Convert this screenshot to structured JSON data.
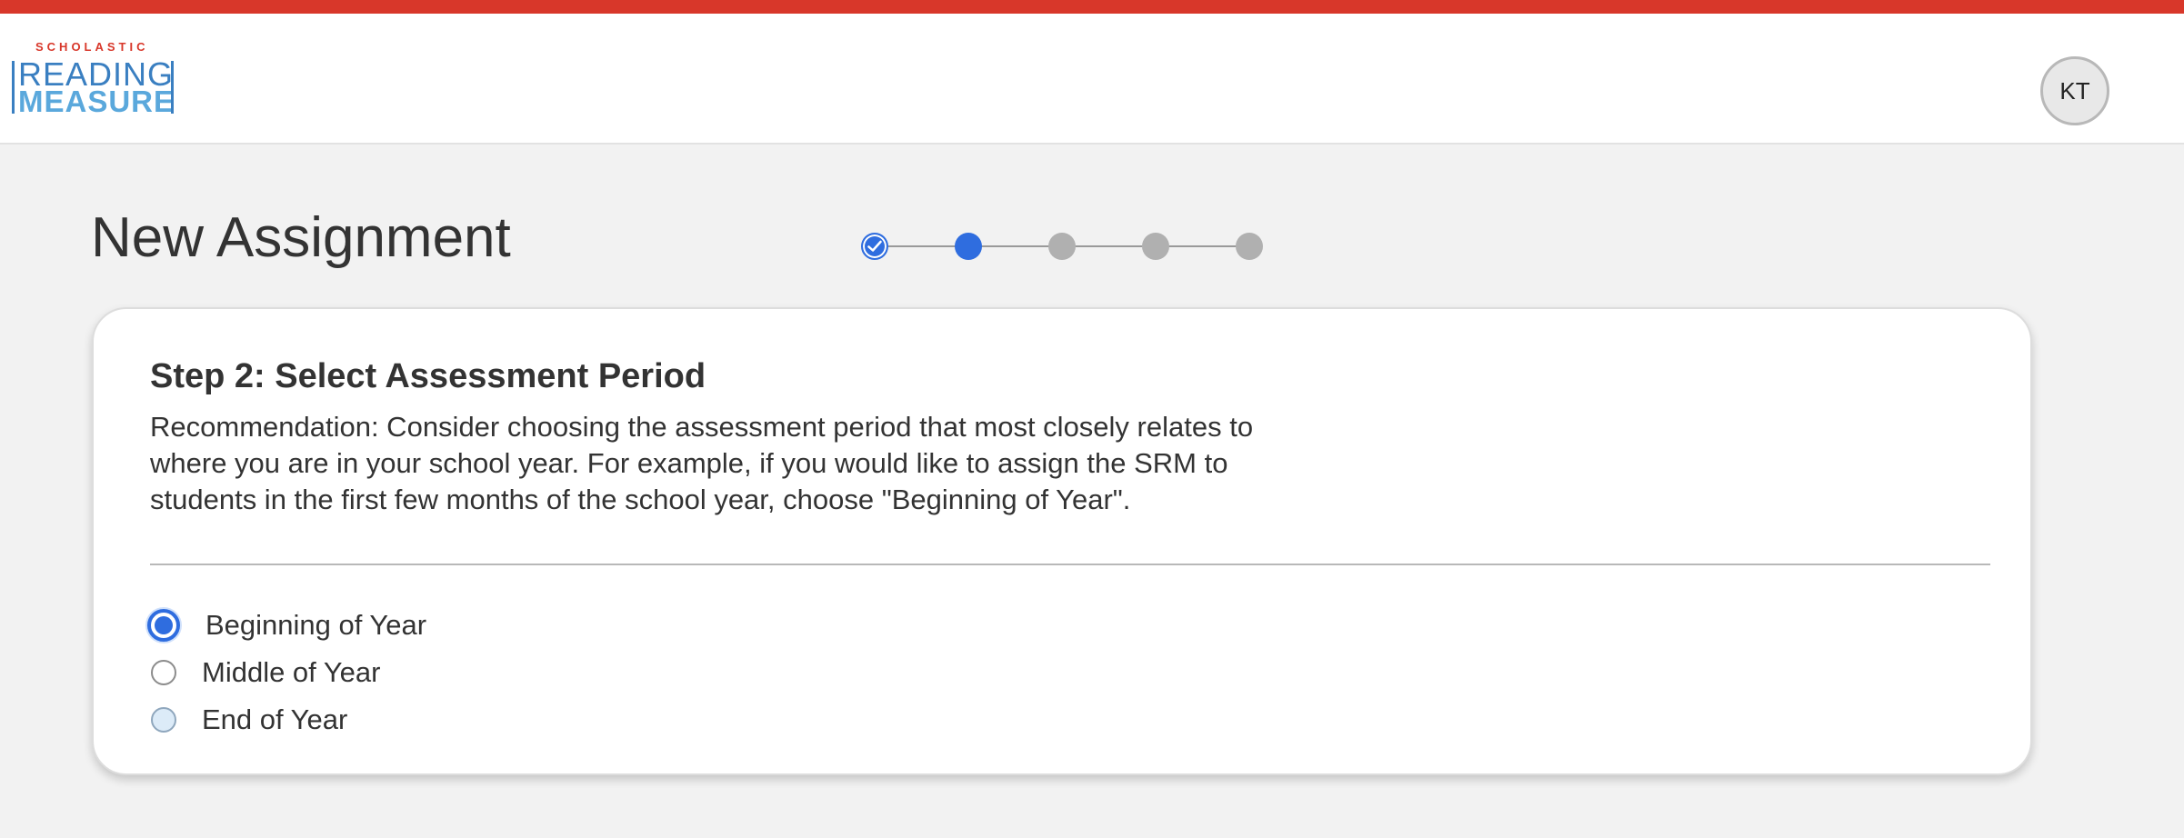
{
  "header": {
    "logo": {
      "brand": "SCHOLASTIC",
      "line1": "READING",
      "line2": "MEASURE"
    },
    "avatar_initials": "KT",
    "accent_color": "#d8372a"
  },
  "page": {
    "title": "New Assignment"
  },
  "stepper": {
    "total_steps": 5,
    "current_step": 2,
    "completed_steps": 1,
    "active_color": "#2f6ddf",
    "inactive_color": "#b0b0b0",
    "icons": [
      "check-icon"
    ]
  },
  "card": {
    "title": "Step 2: Select Assessment Period",
    "description": "Recommendation: Consider choosing the assessment period that most closely relates to where you are in your school year. For example, if you would like to assign the SRM to students in the first few months of the school year, choose \"Beginning of Year\".",
    "options": [
      {
        "label": "Beginning of Year",
        "selected": true
      },
      {
        "label": "Middle of Year",
        "selected": false
      },
      {
        "label": "End of Year",
        "selected": false
      }
    ]
  }
}
